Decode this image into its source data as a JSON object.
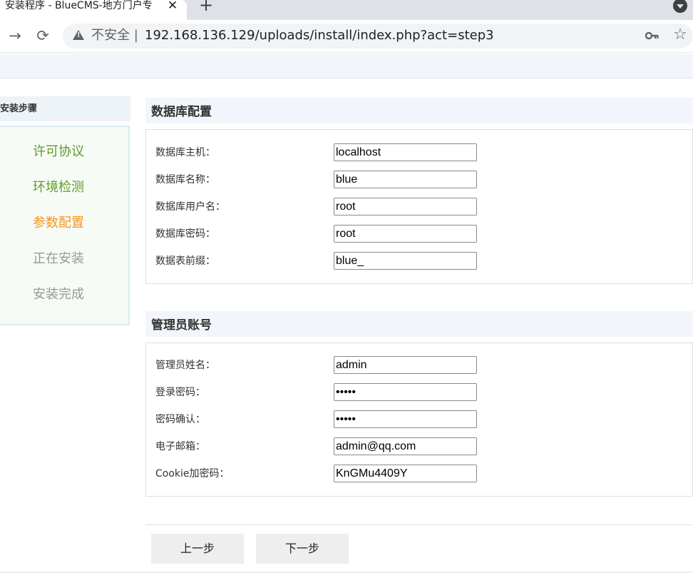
{
  "browser": {
    "tab_title": "安装程序 - BlueCMS-地方门户专",
    "tab_close": "✕",
    "new_tab": "+",
    "back": "→",
    "reload": "⟳",
    "insecure_label": "不安全 |",
    "url": "192.168.136.129/uploads/install/index.php?act=step3",
    "icons": [
      "warning-icon",
      "key-icon",
      "star-icon",
      "tab-menu-icon"
    ]
  },
  "steps": {
    "title": "安装步骤",
    "items": [
      {
        "label": "许可协议",
        "color": "#5e9b2d"
      },
      {
        "label": "环境检测",
        "color": "#5e9b2d"
      },
      {
        "label": "参数配置",
        "color": "#f7941d"
      },
      {
        "label": "正在安装",
        "color": "#999999"
      },
      {
        "label": "安装完成",
        "color": "#999999"
      }
    ]
  },
  "db_section": {
    "title": "数据库配置",
    "rows": [
      {
        "label": "数据库主机：",
        "value": "localhost"
      },
      {
        "label": "数据库名称：",
        "value": "blue"
      },
      {
        "label": "数据库用户名：",
        "value": "root"
      },
      {
        "label": "数据库密码：",
        "value": "root"
      },
      {
        "label": "数据表前缀：",
        "value": "blue_"
      }
    ]
  },
  "admin_section": {
    "title": "管理员账号",
    "rows": [
      {
        "label": "管理员姓名：",
        "value": "admin"
      },
      {
        "label": "登录密码：",
        "value": "•••••"
      },
      {
        "label": "密码确认：",
        "value": "•••••"
      },
      {
        "label": "电子邮箱：",
        "value": "admin@qq.com"
      },
      {
        "label": "Cookie加密码：",
        "value": "KnGMu4409Y"
      }
    ]
  },
  "buttons": {
    "prev": "上一步",
    "next": "下一步"
  }
}
